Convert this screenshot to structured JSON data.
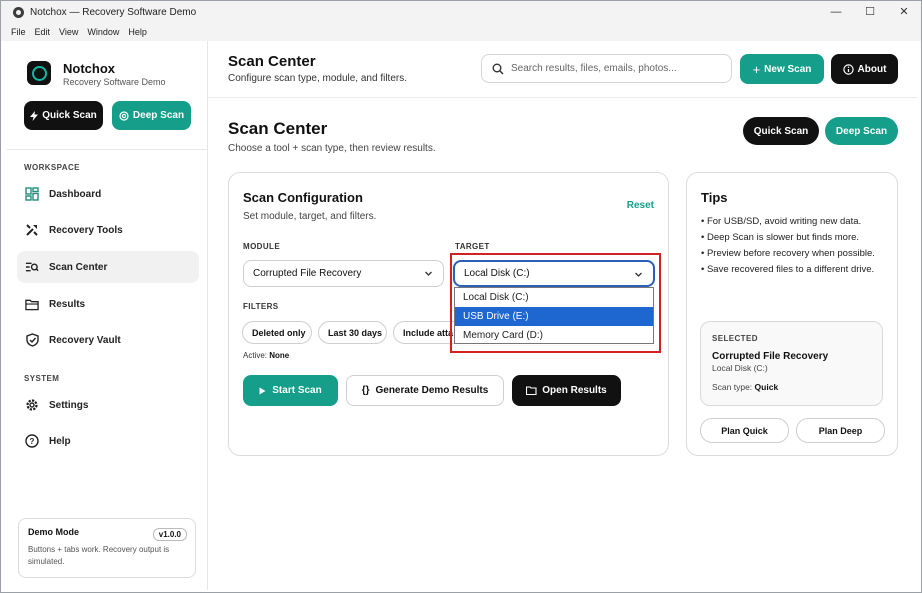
{
  "window": {
    "title": "Notchox — Recovery Software Demo",
    "controls": {
      "minimize": "—",
      "maximize": "☐",
      "close": "✕"
    }
  },
  "menu": [
    "File",
    "Edit",
    "View",
    "Window",
    "Help"
  ],
  "sidebar": {
    "brand_name": "Notchox",
    "brand_sub": "Recovery Software Demo",
    "quick_scan": "Quick Scan",
    "deep_scan": "Deep Scan",
    "workspace_label": "WORKSPACE",
    "system_label": "SYSTEM",
    "workspace_items": [
      {
        "label": "Dashboard",
        "icon": "dashboard-icon"
      },
      {
        "label": "Recovery Tools",
        "icon": "tools-icon"
      },
      {
        "label": "Scan Center",
        "icon": "scan-center-icon",
        "active": true
      },
      {
        "label": "Results",
        "icon": "folder-icon"
      },
      {
        "label": "Recovery Vault",
        "icon": "shield-icon"
      }
    ],
    "system_items": [
      {
        "label": "Settings",
        "icon": "gear-icon"
      },
      {
        "label": "Help",
        "icon": "help-icon"
      }
    ],
    "demo": {
      "title": "Demo Mode",
      "version": "v1.0.0",
      "text": "Buttons + tabs work. Recovery output is simulated."
    }
  },
  "header": {
    "title": "Scan Center",
    "subtitle": "Configure scan type, module, and filters.",
    "search_placeholder": "Search results, files, emails, photos...",
    "new_scan": "New Scan",
    "about": "About"
  },
  "page": {
    "title": "Scan Center",
    "subtitle": "Choose a tool + scan type, then review results.",
    "quick_scan": "Quick Scan",
    "deep_scan": "Deep Scan"
  },
  "config": {
    "title": "Scan Configuration",
    "subtitle": "Set module, target, and filters.",
    "reset": "Reset",
    "module_label": "MODULE",
    "module_value": "Corrupted File Recovery",
    "target_label": "TARGET",
    "target_value": "Local Disk (C:)",
    "target_options": [
      "Local Disk (C:)",
      "USB Drive (E:)",
      "Memory Card (D:)"
    ],
    "highlighted_option": 1,
    "filters_label": "FILTERS",
    "filters": [
      "Deleted only",
      "Last 30 days",
      "Include atta"
    ],
    "active_label": "Active:",
    "active_value": "None",
    "start_scan": "Start Scan",
    "generate_demo": "Generate Demo Results",
    "open_results": "Open Results"
  },
  "tips": {
    "title": "Tips",
    "items": [
      "• For USB/SD, avoid writing new data.",
      "• Deep Scan is slower but finds more.",
      "• Preview before recovery when possible.",
      "• Save recovered files to a different drive."
    ],
    "selected_label": "SELECTED",
    "selected_name": "Corrupted File Recovery",
    "selected_target": "Local Disk (C:)",
    "scan_type_label": "Scan type:",
    "scan_type_value": "Quick",
    "plan_quick": "Plan Quick",
    "plan_deep": "Plan Deep"
  },
  "colors": {
    "accent": "#159e8a",
    "dark": "#111111",
    "highlight": "#1e66d0",
    "annotation": "#d32020"
  }
}
